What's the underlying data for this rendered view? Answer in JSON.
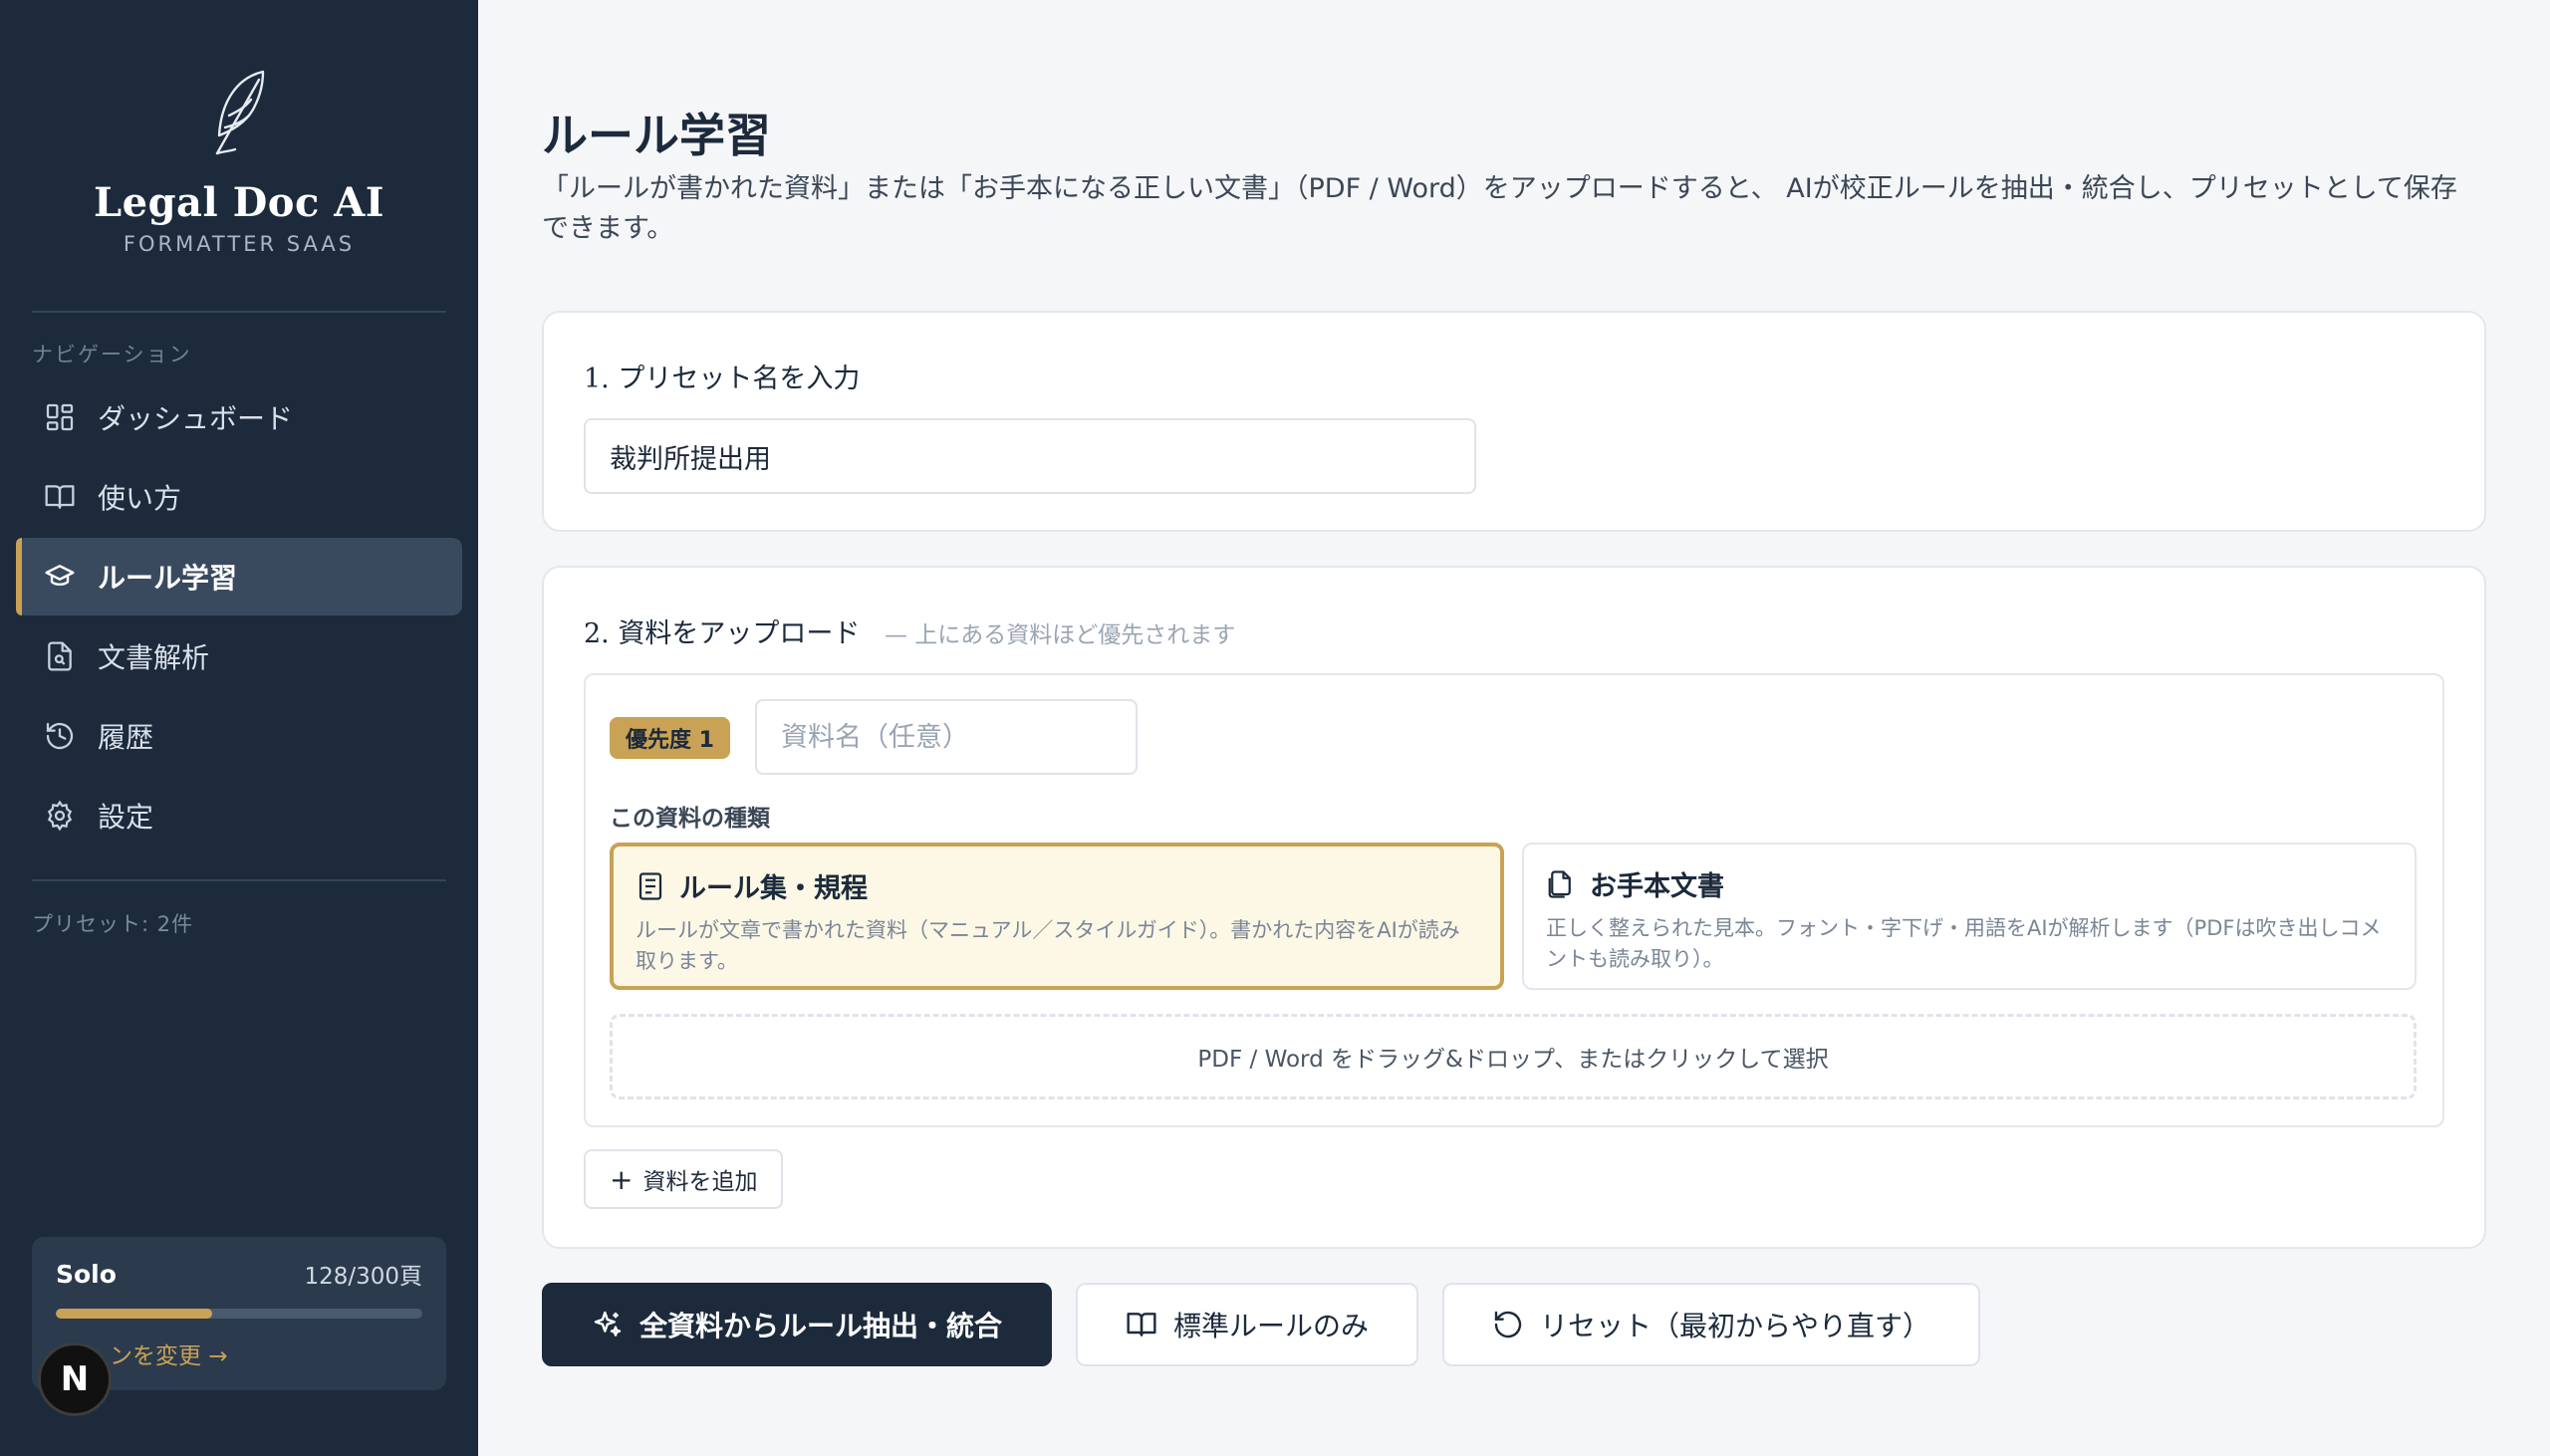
{
  "sidebar": {
    "brand_title": "Legal Doc AI",
    "brand_subtitle": "FORMATTER SAAS",
    "nav_caption": "ナビゲーション",
    "items": [
      {
        "label": "ダッシュボード",
        "icon": "dashboard-grid-icon"
      },
      {
        "label": "使い方",
        "icon": "book-icon"
      },
      {
        "label": "ルール学習",
        "icon": "graduation-cap-icon",
        "active": true
      },
      {
        "label": "文書解析",
        "icon": "document-search-icon"
      },
      {
        "label": "履歴",
        "icon": "history-icon"
      },
      {
        "label": "設定",
        "icon": "gear-icon"
      }
    ],
    "preset_count": "プリセット: 2件",
    "plan": {
      "name": "Solo",
      "usage": "128/300頁",
      "progress": 0.427,
      "link": "ンを変更"
    },
    "badge_letter": "N"
  },
  "main": {
    "title": "ルール学習",
    "description": "「ルールが書かれた資料」または「お手本になる正しい文書」（PDF / Word）をアップロードすると、 AIが校正ルールを抽出・統合し、プリセットとして保存できます。",
    "step1": {
      "title": "1. プリセット名を入力",
      "value": "裁判所提出用"
    },
    "step2": {
      "title": "2. 資料をアップロード",
      "note": "— 上にある資料ほど優先されます",
      "priority_label": "優先度 1",
      "docname_placeholder": "資料名（任意）",
      "type_caption": "この資料の種類",
      "options": [
        {
          "title": "ルール集・規程",
          "desc": "ルールが文章で書かれた資料（マニュアル／スタイルガイド）。書かれた内容をAIが読み取ります。",
          "selected": true
        },
        {
          "title": "お手本文書",
          "desc": "正しく整えられた見本。フォント・字下げ・用語をAIが解析します（PDFは吹き出しコメントも読み取り）。",
          "selected": false
        }
      ],
      "dropzone": "PDF / Word をドラッグ&ドロップ、またはクリックして選択",
      "add_button": "資料を追加"
    },
    "actions": {
      "extract": "全資料からルール抽出・統合",
      "standard": "標準ルールのみ",
      "reset": "リセット（最初からやり直す）"
    }
  },
  "colors": {
    "sidebar_bg": "#1c2a3c",
    "accent_gold": "#c9a256",
    "page_bg": "#f5f6f8"
  }
}
